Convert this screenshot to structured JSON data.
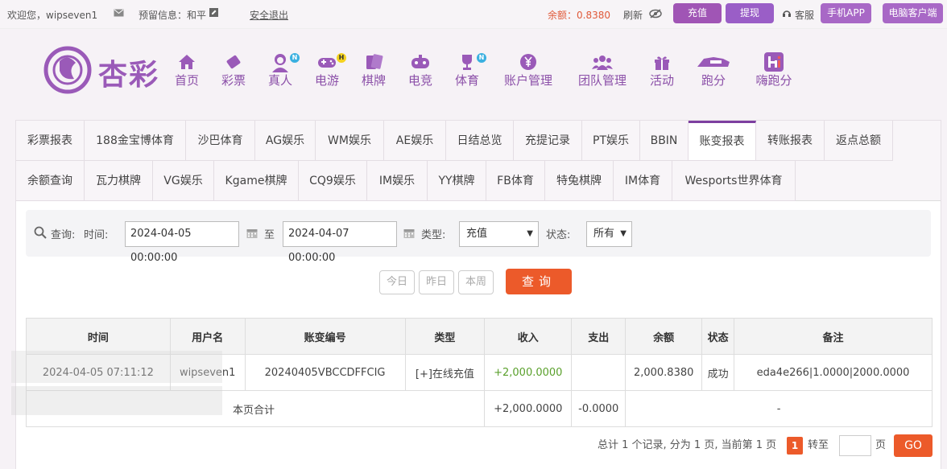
{
  "topbar": {
    "welcome": "欢迎您，wipseven1",
    "reserved": "预留信息：和平",
    "logout": "安全退出",
    "balance_label": "余额：",
    "balance_value": "0.8380",
    "refresh": "刷新",
    "recharge": "充值",
    "withdraw": "提现",
    "service": "客服",
    "mobile_app": "手机APP",
    "pc_client": "电脑客户端"
  },
  "logo": {
    "text": "杏彩"
  },
  "nav": {
    "items": [
      {
        "label": "首页",
        "icon": "home-icon"
      },
      {
        "label": "彩票",
        "icon": "lottery-icon"
      },
      {
        "label": "真人",
        "icon": "live-dealer-icon",
        "badge": "N"
      },
      {
        "label": "电游",
        "icon": "gamepad-icon",
        "badge": "H"
      },
      {
        "label": "棋牌",
        "icon": "cards-icon"
      },
      {
        "label": "电竞",
        "icon": "esports-icon"
      },
      {
        "label": "体育",
        "icon": "trophy-icon",
        "badge": "N"
      },
      {
        "label": "账户管理",
        "icon": "yen-coin-icon"
      },
      {
        "label": "团队管理",
        "icon": "team-icon"
      },
      {
        "label": "活动",
        "icon": "gift-icon"
      },
      {
        "label": "跑分",
        "icon": "runner-icon"
      },
      {
        "label": "嗨跑分",
        "icon": "hi-icon"
      }
    ]
  },
  "tabs": {
    "row1": [
      "彩票报表",
      "188金宝博体育",
      "沙巴体育",
      "AG娱乐",
      "WM娱乐",
      "AE娱乐",
      "日结总览",
      "充提记录",
      "PT娱乐",
      "BBIN",
      "账变报表",
      "转账报表",
      "返点总额"
    ],
    "row2": [
      "余额查询",
      "瓦力棋牌",
      "VG娱乐",
      "Kgame棋牌",
      "CQ9娱乐",
      "IM娱乐",
      "YY棋牌",
      "FB体育",
      "特兔棋牌",
      "IM体育",
      "Wesports世界体育"
    ],
    "active": "账变报表"
  },
  "filter": {
    "query_label": "查询:",
    "time_label": "时间:",
    "start_time": "2024-04-05 00:00:00",
    "to_label": "至",
    "end_time": "2024-04-07 00:00:00",
    "type_label": "类型:",
    "type_value": "充值",
    "status_label": "状态:",
    "status_value": "所有",
    "today": "今日",
    "yesterday": "昨日",
    "this_week": "本周",
    "search": "查询"
  },
  "table": {
    "headers": [
      "时间",
      "用户名",
      "账变编号",
      "类型",
      "收入",
      "支出",
      "余额",
      "状态",
      "备注"
    ],
    "rows": [
      {
        "time": "2024-04-05 07:11:12",
        "user": "wipseven1",
        "id": "20240405VBCCDFFCIG",
        "type": "[+]在线充值",
        "income": "+2,000.0000",
        "expense": "",
        "balance": "2,000.8380",
        "status": "成功",
        "note": "eda4e266|1.0000|2000.0000"
      }
    ],
    "summary": {
      "label": "本页合计",
      "income": "+2,000.0000",
      "expense": "-0.0000",
      "note": "-"
    }
  },
  "pager": {
    "summary": "总计 1 个记录, 分为 1 页, 当前第 1 页",
    "current_page": "1",
    "goto_label": "转至",
    "page_unit": "页",
    "go": "GO"
  },
  "colors": {
    "brand": "#9a5ab8",
    "accent": "#ec5a2a",
    "income": "#5aa02c"
  }
}
